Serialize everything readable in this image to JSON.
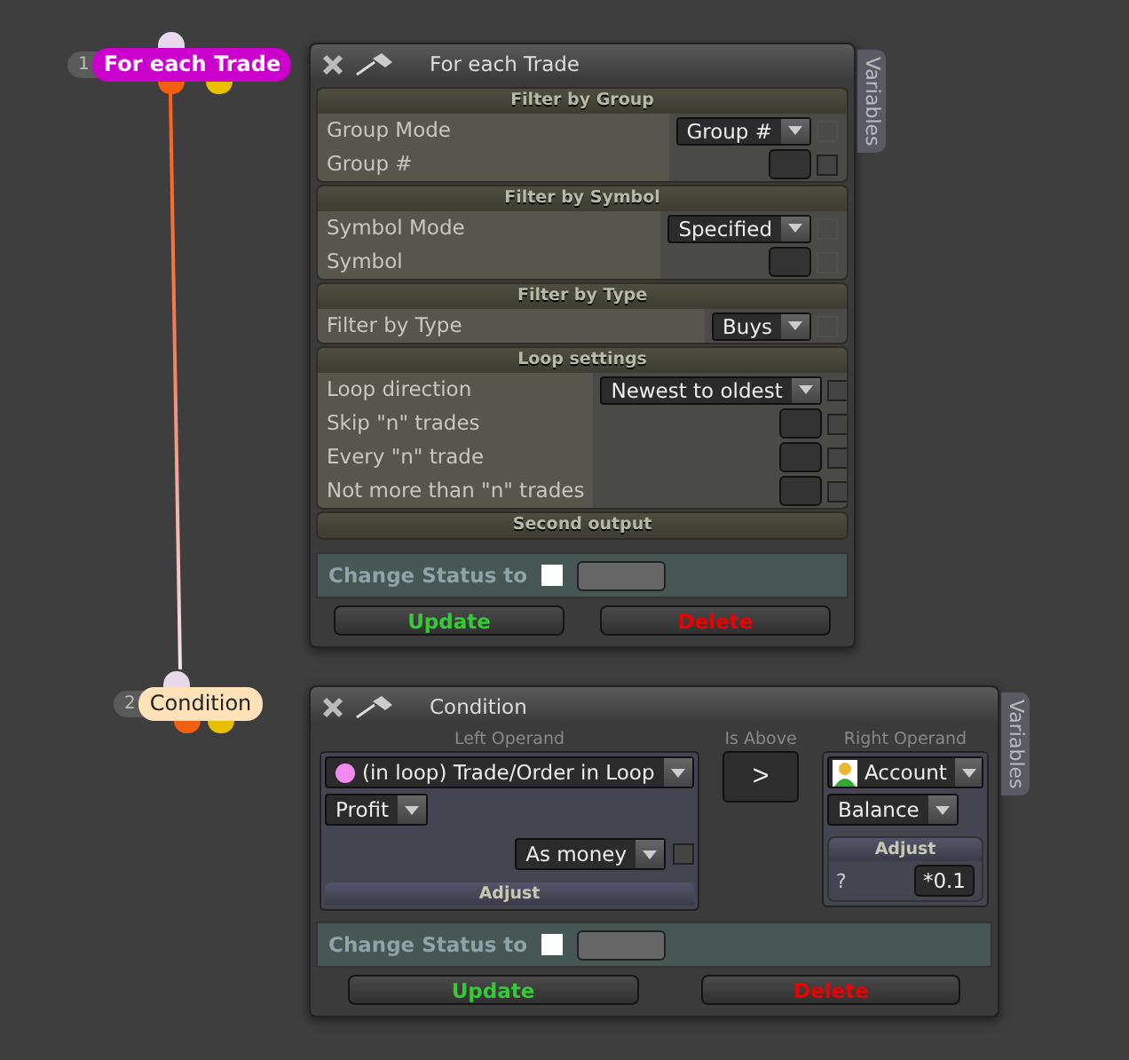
{
  "nodes": [
    {
      "number": "1",
      "label": "For each Trade",
      "color": "#cc00cc"
    },
    {
      "number": "2",
      "label": "Condition",
      "color": "#ffe2b8"
    }
  ],
  "trade_panel": {
    "title": "For each Trade",
    "side_tab": "Variables",
    "sections": [
      {
        "title": "Filter by Group",
        "rows": [
          {
            "label": "Group Mode",
            "kind": "dropdown",
            "value": "Group #",
            "disabled": true
          },
          {
            "label": "Group #",
            "kind": "input",
            "disabled": false
          }
        ]
      },
      {
        "title": "Filter by Symbol",
        "rows": [
          {
            "label": "Symbol Mode",
            "kind": "dropdown",
            "value": "Specified",
            "disabled": true
          },
          {
            "label": "Symbol",
            "kind": "input",
            "disabled": true
          }
        ]
      },
      {
        "title": "Filter by Type",
        "rows": [
          {
            "label": "Filter by Type",
            "kind": "dropdown",
            "value": "Buys",
            "disabled": true
          }
        ]
      },
      {
        "title": "Loop settings",
        "rows": [
          {
            "label": "Loop direction",
            "kind": "dropdown",
            "value": "Newest to oldest",
            "disabled": false
          },
          {
            "label": "Skip \"n\" trades",
            "kind": "input",
            "disabled": false
          },
          {
            "label": "Every \"n\" trade",
            "kind": "input",
            "disabled": false
          },
          {
            "label": "Not more than \"n\" trades",
            "kind": "input",
            "disabled": false
          }
        ]
      },
      {
        "title": "Second output"
      }
    ],
    "status_label": "Change Status to",
    "status_checked": false,
    "buttons": [
      {
        "label": "Update",
        "kind": "update"
      },
      {
        "label": "Delete",
        "kind": "delete"
      }
    ]
  },
  "condition_panel": {
    "title": "Condition",
    "side_tab": "Variables",
    "left_operand": {
      "heading": "Left Operand",
      "source": "(in loop) Trade/Order in Loop",
      "field": "Profit",
      "format": "As money",
      "format_checked": false,
      "adjust": "Adjust"
    },
    "operator": {
      "heading": "Is Above",
      "symbol": ">"
    },
    "right_operand": {
      "heading": "Right Operand",
      "source": "Account",
      "field": "Balance",
      "adjust_heading": "Adjust",
      "adjust_label": "?",
      "adjust_value": "*0.1"
    },
    "status_label": "Change Status to",
    "status_checked": false,
    "buttons": [
      {
        "label": "Update",
        "kind": "update"
      },
      {
        "label": "Delete",
        "kind": "delete"
      }
    ]
  }
}
